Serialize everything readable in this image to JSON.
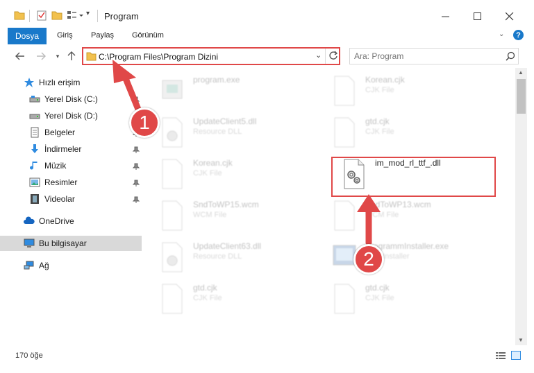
{
  "window": {
    "title": "Program"
  },
  "ribbon": {
    "tabs": [
      "Dosya",
      "Giriş",
      "Paylaş",
      "Görünüm"
    ]
  },
  "address": {
    "path": "C:\\Program Files\\Program Dizini"
  },
  "search": {
    "placeholder": "Ara: Program"
  },
  "sidebar": {
    "quick_access": "Hızlı erişim",
    "items": [
      {
        "label": "Yerel Disk (C:)",
        "icon": "drive-icon"
      },
      {
        "label": "Yerel Disk (D:)",
        "icon": "drive-icon"
      },
      {
        "label": "Belgeler",
        "icon": "documents-icon"
      },
      {
        "label": "İndirmeler",
        "icon": "download-icon"
      },
      {
        "label": "Müzik",
        "icon": "music-icon"
      },
      {
        "label": "Resimler",
        "icon": "pictures-icon"
      },
      {
        "label": "Videolar",
        "icon": "video-icon"
      }
    ],
    "onedrive": "OneDrive",
    "this_pc": "Bu bilgisayar",
    "network": "Ağ"
  },
  "files": [
    {
      "name": "program.exe",
      "type": ""
    },
    {
      "name": "Korean.cjk",
      "type": "CJK File"
    },
    {
      "name": "UpdateClient5.dll",
      "type": "Resource DLL"
    },
    {
      "name": "gtd.cjk",
      "type": "CJK File"
    },
    {
      "name": "Korean.cjk",
      "type": "CJK File"
    },
    {
      "name": "im_mod_rl_ttf_.dll",
      "type": ""
    },
    {
      "name": "SndToWP15.wcm",
      "type": "WCM File"
    },
    {
      "name": "SndToWP13.wcm",
      "type": "WCM File"
    },
    {
      "name": "UpdateClient63.dll",
      "type": "Resource DLL"
    },
    {
      "name": "ProgrammInstaller.exe",
      "type": "EXE Installer"
    },
    {
      "name": "gtd.cjk",
      "type": "CJK File"
    },
    {
      "name": "gtd.cjk",
      "type": "CJK File"
    }
  ],
  "status": {
    "item_count": "170 öğe"
  },
  "annotations": {
    "step1": "1",
    "step2": "2"
  },
  "colors": {
    "accent": "#1979ca",
    "highlight": "#e04848",
    "selected": "#d9d9d9"
  }
}
